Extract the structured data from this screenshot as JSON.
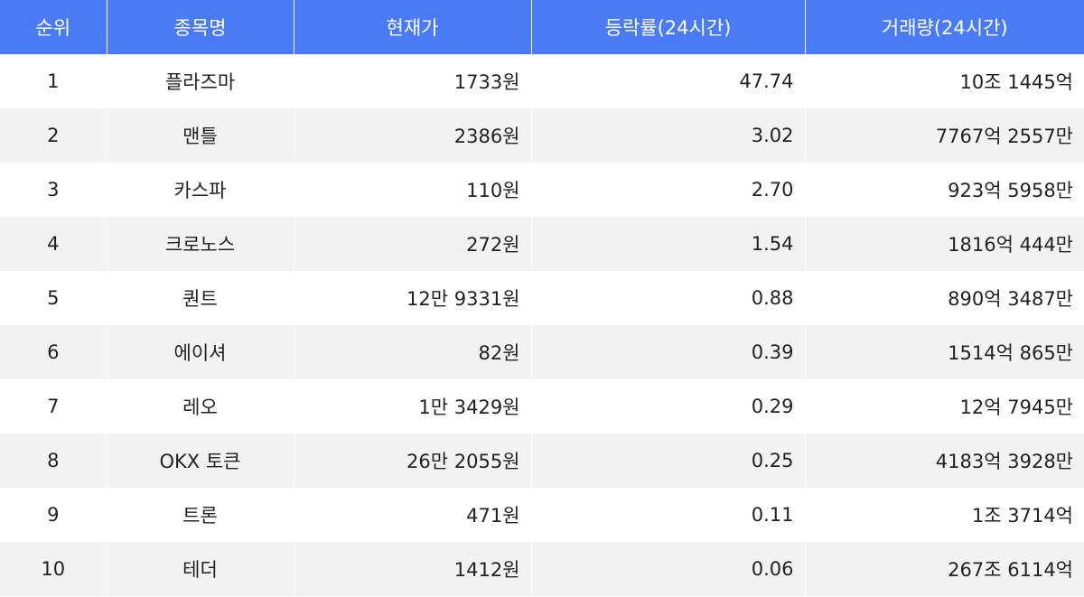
{
  "table": {
    "headers": [
      "순위",
      "종목명",
      "현재가",
      "등락률(24시간)",
      "거래량(24시간)"
    ],
    "rows": [
      {
        "rank": "1",
        "name": "플라즈마",
        "price": "1733원",
        "change": "47.74",
        "volume": "10조 1445억"
      },
      {
        "rank": "2",
        "name": "맨틀",
        "price": "2386원",
        "change": "3.02",
        "volume": "7767억 2557만"
      },
      {
        "rank": "3",
        "name": "카스파",
        "price": "110원",
        "change": "2.70",
        "volume": "923억 5958만"
      },
      {
        "rank": "4",
        "name": "크로노스",
        "price": "272원",
        "change": "1.54",
        "volume": "1816억 444만"
      },
      {
        "rank": "5",
        "name": "퀀트",
        "price": "12만 9331원",
        "change": "0.88",
        "volume": "890억 3487만"
      },
      {
        "rank": "6",
        "name": "에이셔",
        "price": "82원",
        "change": "0.39",
        "volume": "1514억 865만"
      },
      {
        "rank": "7",
        "name": "레오",
        "price": "1만 3429원",
        "change": "0.29",
        "volume": "12억 7945만"
      },
      {
        "rank": "8",
        "name": "OKX 토큰",
        "price": "26만 2055원",
        "change": "0.25",
        "volume": "4183억 3928만"
      },
      {
        "rank": "9",
        "name": "트론",
        "price": "471원",
        "change": "0.11",
        "volume": "1조 3714억"
      },
      {
        "rank": "10",
        "name": "테더",
        "price": "1412원",
        "change": "0.06",
        "volume": "267조 6114억"
      }
    ]
  },
  "colors": {
    "header_bg": "#4a7bf7",
    "header_text": "#ffffff",
    "row_alt_bg": "#f2f2f2"
  }
}
